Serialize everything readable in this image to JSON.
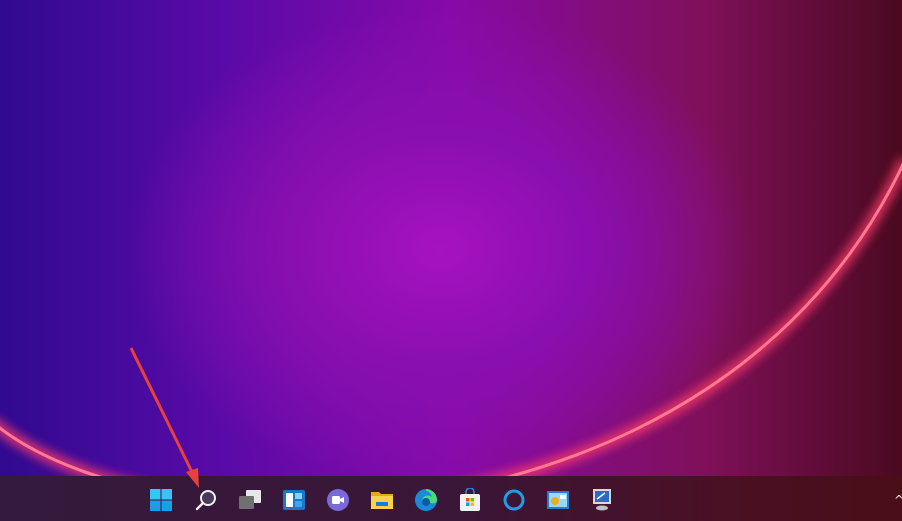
{
  "desktop": {
    "wallpaper": "windows-11-bloom-purple"
  },
  "taskbar": {
    "icons": [
      "start-icon",
      "search-icon",
      "task-view-icon",
      "widgets-icon",
      "teams-chat-icon",
      "file-explorer-icon",
      "edge-icon",
      "microsoft-store-icon",
      "cortana-icon",
      "control-panel-icon",
      "this-pc-icon"
    ],
    "tray": {
      "overflow": "^"
    }
  },
  "annotation": {
    "color": "#e8403a",
    "points_to": "search-icon"
  }
}
